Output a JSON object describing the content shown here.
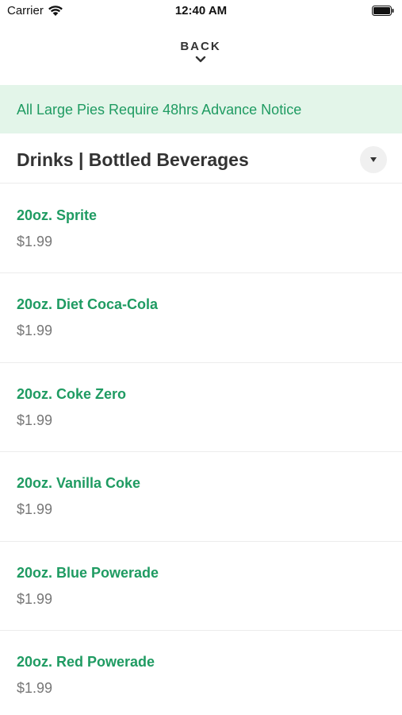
{
  "status_bar": {
    "carrier": "Carrier",
    "time": "12:40 AM"
  },
  "back": {
    "label": "BACK"
  },
  "notice": {
    "text": "All Large Pies Require 48hrs Advance Notice"
  },
  "section": {
    "title": "Drinks | Bottled Beverages"
  },
  "items": [
    {
      "name": "20oz. Sprite",
      "price": "$1.99"
    },
    {
      "name": "20oz. Diet Coca-Cola",
      "price": "$1.99"
    },
    {
      "name": "20oz. Coke Zero",
      "price": "$1.99"
    },
    {
      "name": "20oz. Vanilla Coke",
      "price": "$1.99"
    },
    {
      "name": "20oz. Blue Powerade",
      "price": "$1.99"
    },
    {
      "name": "20oz. Red Powerade",
      "price": "$1.99"
    }
  ],
  "colors": {
    "accent_green": "#1f9b62",
    "notice_background": "#e3f5e9",
    "price_gray": "#777777"
  },
  "icons": [
    "wifi-icon",
    "battery-icon",
    "chevron-down-icon",
    "caret-down-icon"
  ]
}
